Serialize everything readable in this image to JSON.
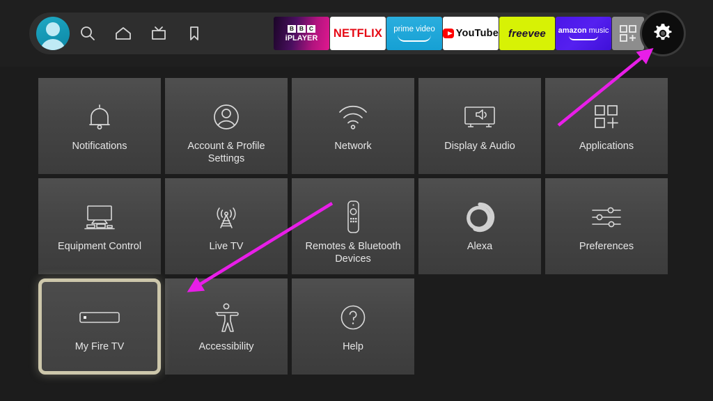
{
  "window": {
    "background_color": "#1c1c1c",
    "tile_color": "#474747",
    "selection_border_color": "#cdc7ab",
    "annotation_color": "#e81ee8"
  },
  "topbar": {
    "avatar": {
      "name": "profile-avatar"
    },
    "nav_icons": [
      {
        "name": "search-icon",
        "label": "Search"
      },
      {
        "name": "home-icon",
        "label": "Home"
      },
      {
        "name": "live-tv-icon",
        "label": "Live TV"
      },
      {
        "name": "bookmark-icon",
        "label": "Watchlist"
      }
    ],
    "apps": [
      {
        "name": "bbc-iplayer",
        "line1": "BBC",
        "label": "iPLAYER",
        "color": "#b3147f"
      },
      {
        "name": "netflix",
        "label": "NETFLIX",
        "color": "#e50914"
      },
      {
        "name": "prime-video",
        "line1": "prime video",
        "label": "prime video",
        "color": "#1ba0d7"
      },
      {
        "name": "youtube",
        "label": "YouTube",
        "color": "#ff0000"
      },
      {
        "name": "freevee",
        "label": "freevee",
        "color": "#d7f205"
      },
      {
        "name": "amazon-music",
        "line1": "amazon",
        "line2": "music",
        "label": "amazon music",
        "color": "#4b16e8"
      }
    ],
    "apps_grid_button": {
      "name": "apps-grid-button",
      "label": "Apps"
    },
    "settings_button": {
      "name": "settings-gear-button",
      "label": "Settings",
      "selected": true
    }
  },
  "settings": {
    "tiles": [
      {
        "label": "Notifications",
        "icon": "bell-icon",
        "selected": false
      },
      {
        "label": "Account & Profile Settings",
        "icon": "person-circle-icon",
        "selected": false
      },
      {
        "label": "Network",
        "icon": "wifi-icon",
        "selected": false
      },
      {
        "label": "Display & Audio",
        "icon": "display-audio-icon",
        "selected": false
      },
      {
        "label": "Applications",
        "icon": "applications-grid-icon",
        "selected": false
      },
      {
        "label": "Equipment Control",
        "icon": "equipment-control-icon",
        "selected": false
      },
      {
        "label": "Live TV",
        "icon": "broadcast-tower-icon",
        "selected": false
      },
      {
        "label": "Remotes & Bluetooth Devices",
        "icon": "remote-control-icon",
        "selected": false
      },
      {
        "label": "Alexa",
        "icon": "alexa-ring-icon",
        "selected": false
      },
      {
        "label": "Preferences",
        "icon": "sliders-icon",
        "selected": false
      },
      {
        "label": "My Fire TV",
        "icon": "fire-tv-stick-icon",
        "selected": true
      },
      {
        "label": "Accessibility",
        "icon": "accessibility-icon",
        "selected": false
      },
      {
        "label": "Help",
        "icon": "question-mark-circle-icon",
        "selected": false
      }
    ]
  },
  "annotations": [
    {
      "name": "arrow-to-settings-gear",
      "points_to": "settings-gear-button"
    },
    {
      "name": "arrow-to-my-fire-tv",
      "points_to": "tile-my-fire-tv"
    }
  ]
}
